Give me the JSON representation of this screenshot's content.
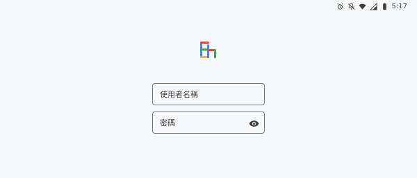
{
  "status_bar": {
    "time": "5:17",
    "icons": [
      "alarm-icon",
      "notifications-off-icon",
      "wifi-icon",
      "signal-icon",
      "battery-icon"
    ]
  },
  "logo": {
    "name": "app-logo",
    "colors": [
      "#ea4335",
      "#fbbc04",
      "#34a853",
      "#4285f4"
    ]
  },
  "login_form": {
    "username": {
      "placeholder": "使用者名稱",
      "value": ""
    },
    "password": {
      "placeholder": "密碼",
      "value": "",
      "toggle_icon": "eye-icon"
    }
  },
  "colors": {
    "background": "#f8f9fb",
    "field_border": "#74777a",
    "icon": "#3c3c3c"
  }
}
